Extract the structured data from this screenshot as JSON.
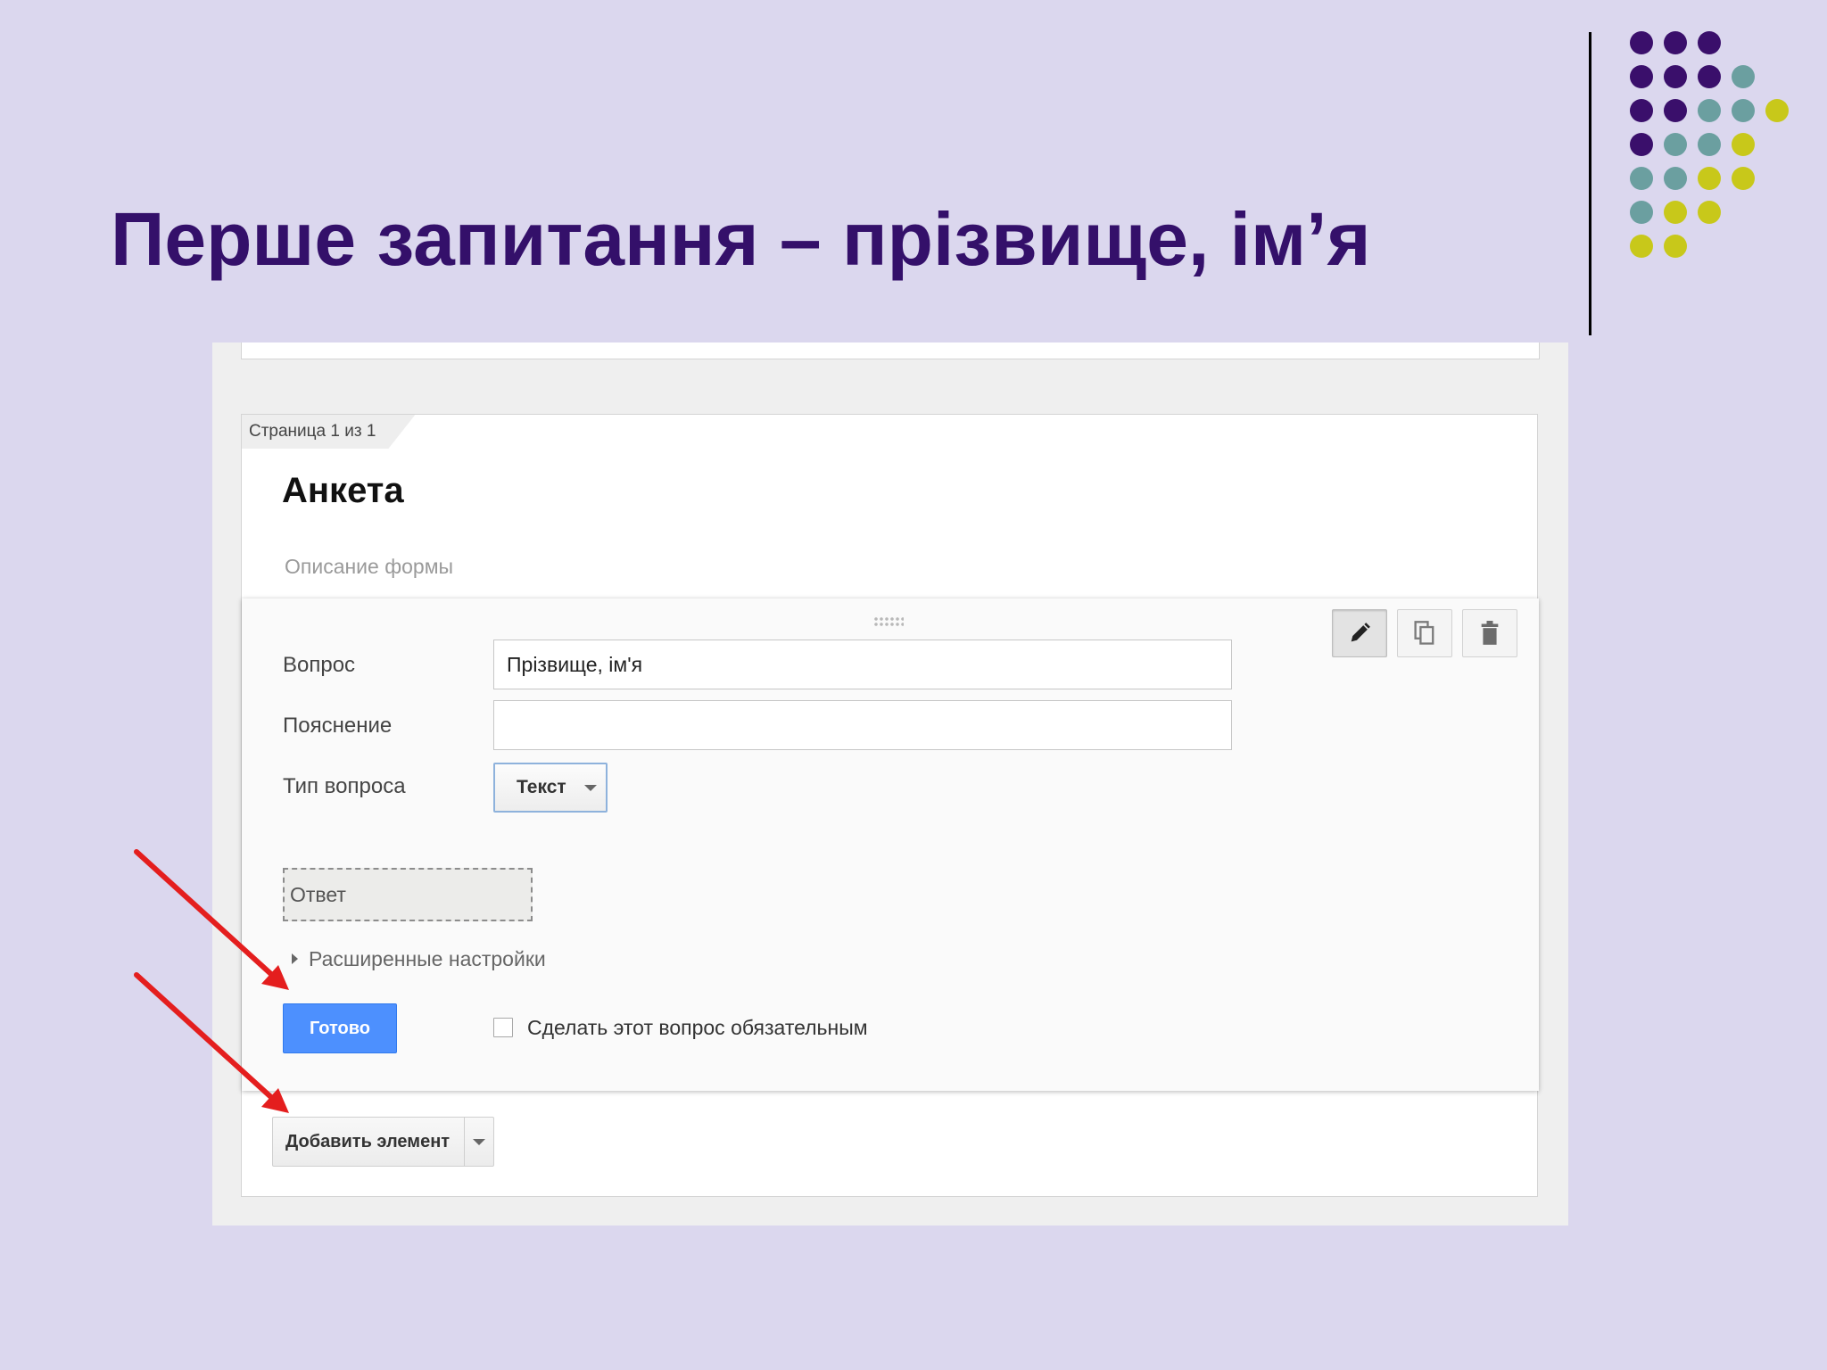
{
  "slide": {
    "title": "Перше запитання – прізвище, ім’я",
    "dot_colors": {
      "purple": "#3a0f6b",
      "teal": "#6b9fa0",
      "yellow": "#c8c81a"
    },
    "arrow_color": "#e41e1e"
  },
  "form": {
    "page_tab": "Страница 1 из 1",
    "title": "Анкета",
    "description_placeholder": "Описание формы",
    "question_editor": {
      "toolbar": {
        "edit_icon": "pencil-icon",
        "duplicate_icon": "copy-icon",
        "delete_icon": "trash-icon"
      },
      "question_label": "Вопрос",
      "question_value": "Прізвище, ім'я",
      "hint_label": "Пояснение",
      "hint_value": "",
      "type_label": "Тип вопроса",
      "type_value": "Текст",
      "answer_preview": "Ответ",
      "advanced_settings": "Расширенные настройки",
      "done_button": "Готово",
      "required_checkbox_label": "Сделать этот вопрос обязательным",
      "required_checked": false
    },
    "add_item_button": "Добавить элемент"
  },
  "colors": {
    "slide_background": "#dbd7ee",
    "title_color": "#34106a",
    "primary_button": "#4d90fe"
  }
}
